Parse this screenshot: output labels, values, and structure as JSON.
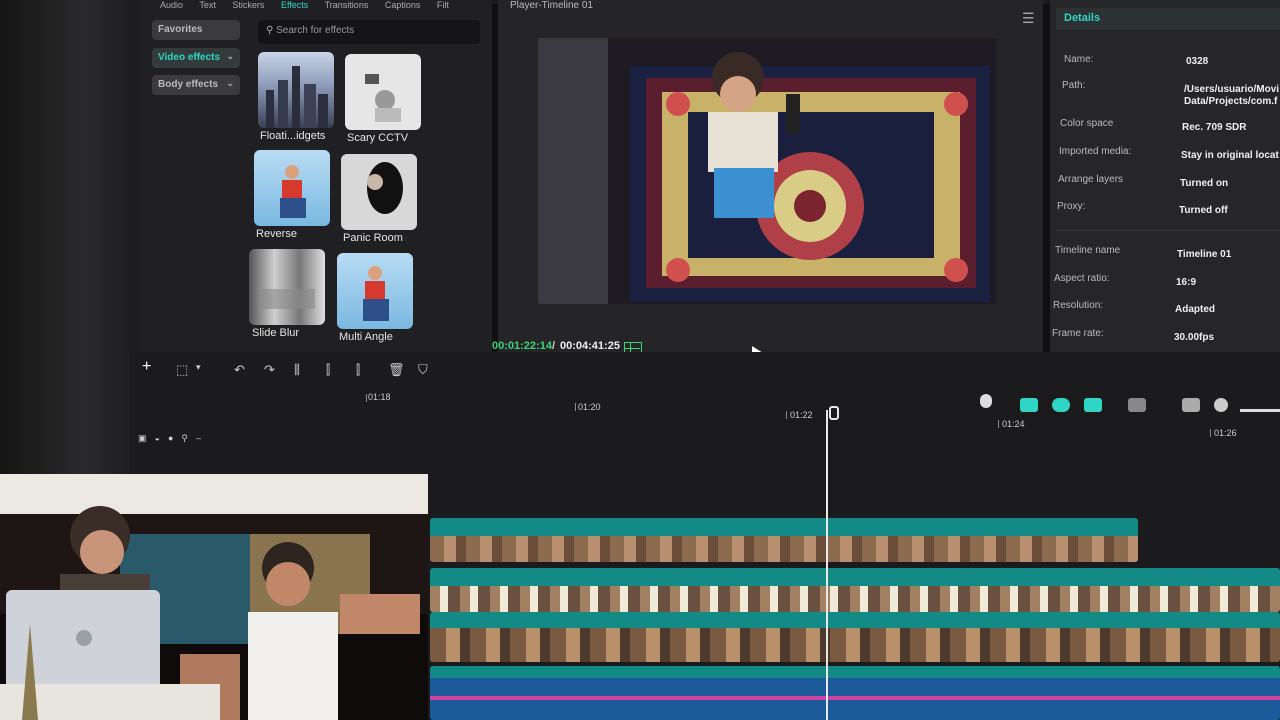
{
  "effects_panel": {
    "tabs": [
      "Audio",
      "Text",
      "Stickers",
      "Effects",
      "Transitions",
      "Captions",
      "Filt"
    ],
    "active_tab": "Effects",
    "sidebar": [
      {
        "label": "Favorites",
        "active": false
      },
      {
        "label": "Video effects",
        "active": true
      },
      {
        "label": "Body effects",
        "active": false
      }
    ],
    "search_placeholder": "Search for effects",
    "effects": [
      {
        "label": "Floati...idgets",
        "icon": "city-thumbnail"
      },
      {
        "label": "Scary CCTV",
        "icon": "cctv-thumbnail"
      },
      {
        "label": "Reverse",
        "icon": "person-thumbnail"
      },
      {
        "label": "Panic Room",
        "icon": "woman-thumbnail"
      },
      {
        "label": "Slide Blur",
        "icon": "blur-thumbnail"
      },
      {
        "label": "Multi Angle",
        "icon": "person-thumbnail"
      }
    ]
  },
  "player": {
    "title": "Player-Timeline 01",
    "current_time": "00:01:22:14",
    "separator": "/",
    "total_time": "00:04:41:25"
  },
  "details": {
    "header": "Details",
    "project_rows": [
      {
        "key": "Name:",
        "value": "0328"
      },
      {
        "key": "Path:",
        "value": "/Users/usuario/Movi\nData/Projects/com.f"
      },
      {
        "key": "Color space",
        "value": "Rec. 709 SDR"
      },
      {
        "key": "Imported media:",
        "value": "Stay in original locat"
      },
      {
        "key": "Arrange layers",
        "value": "Turned on"
      },
      {
        "key": "Proxy:",
        "value": "Turned off"
      }
    ],
    "timeline_rows": [
      {
        "key": "Timeline name",
        "value": "Timeline 01"
      },
      {
        "key": "Aspect ratio:",
        "value": "16:9"
      },
      {
        "key": "Resolution:",
        "value": "Adapted"
      },
      {
        "key": "Frame rate:",
        "value": "30.00fps"
      }
    ]
  },
  "timeline": {
    "ruler_labels": [
      "01:18",
      "01:20",
      "01:22",
      "01:24",
      "01:26"
    ],
    "toolbar_icons": [
      "add-icon",
      "select-icon",
      "undo-icon",
      "redo-icon",
      "split-icon",
      "trim-left-icon",
      "trim-right-icon",
      "delete-icon",
      "marker-icon"
    ]
  },
  "colors": {
    "accent": "#2fd6c4",
    "track": "#148a86",
    "timecode_green": "#3cd27a"
  }
}
